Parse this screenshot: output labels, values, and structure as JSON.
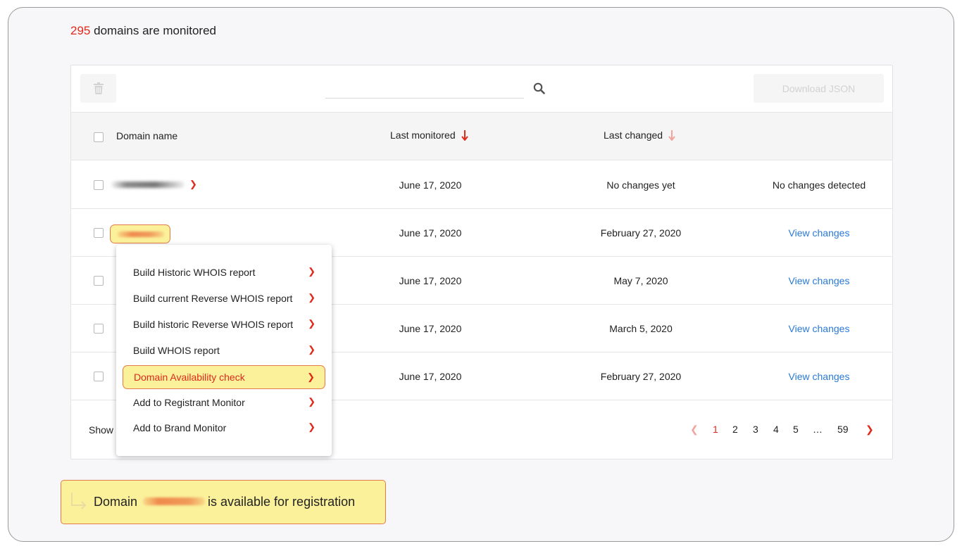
{
  "summary": {
    "count": "295",
    "suffix": "domains are monitored"
  },
  "toolbar": {
    "search_placeholder": "",
    "download_label": "Download JSON"
  },
  "table": {
    "headers": {
      "domain": "Domain name",
      "last_monitored": "Last monitored",
      "last_changed": "Last changed"
    },
    "rows": [
      {
        "last_monitored": "June 17, 2020",
        "last_changed": "No changes yet",
        "action": "No changes detected"
      },
      {
        "last_monitored": "June 17, 2020",
        "last_changed": "February 27, 2020",
        "action": "View changes"
      },
      {
        "last_monitored": "June 17, 2020",
        "last_changed": "May 7, 2020",
        "action": "View changes"
      },
      {
        "last_monitored": "June 17, 2020",
        "last_changed": "March 5, 2020",
        "action": "View changes"
      },
      {
        "last_monitored": "June 17, 2020",
        "last_changed": "February 27, 2020",
        "action": "View changes"
      }
    ]
  },
  "footer": {
    "show_label": "Show",
    "pages": [
      "1",
      "2",
      "3",
      "4",
      "5",
      "…",
      "59"
    ],
    "current_page": "1"
  },
  "context_menu": {
    "items": [
      "Build Historic WHOIS report",
      "Build current Reverse WHOIS report",
      "Build historic Reverse WHOIS report",
      "Build WHOIS report",
      "Domain Availability check",
      "Add to Registrant Monitor",
      "Add to Brand Monitor"
    ],
    "active_item": "Domain Availability check"
  },
  "result": {
    "prefix": "Domain",
    "suffix": "is available for registration"
  },
  "colors": {
    "accent": "#e0291b",
    "link": "#2a7ad7",
    "highlight": "#fbf19b",
    "highlight_border": "#e27a4a"
  }
}
